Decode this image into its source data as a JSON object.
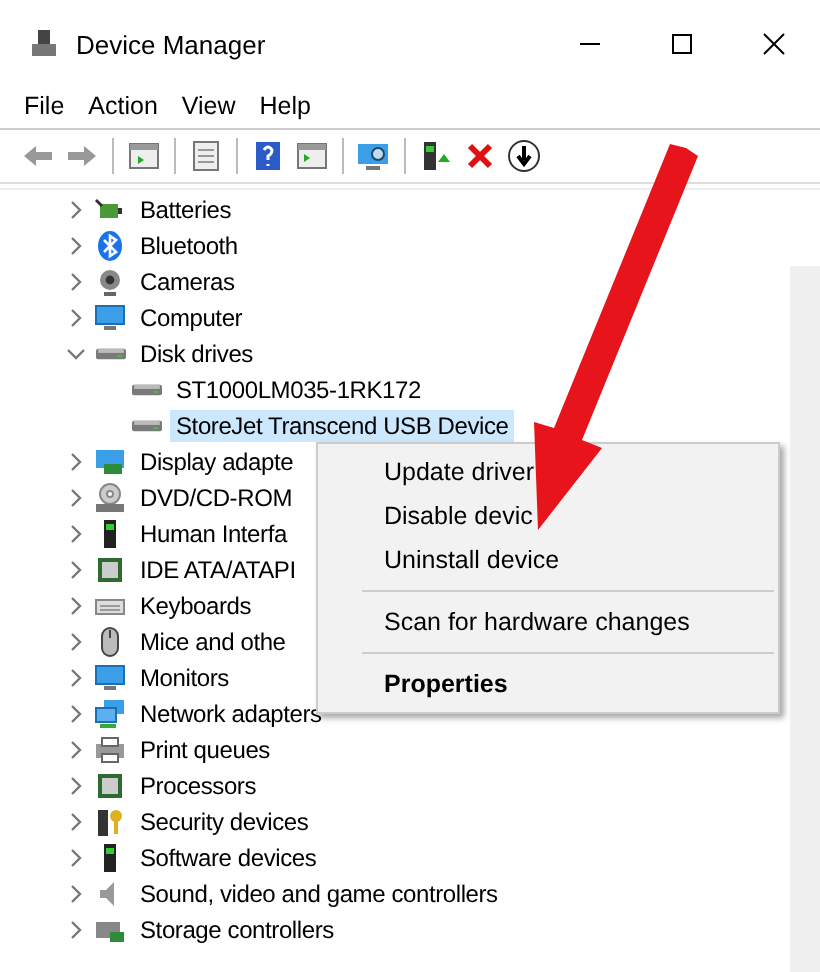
{
  "window": {
    "title": "Device Manager"
  },
  "menu": [
    "File",
    "Action",
    "View",
    "Help"
  ],
  "tree": [
    {
      "label": "Batteries",
      "expanded": false,
      "selected": false
    },
    {
      "label": "Bluetooth",
      "expanded": false,
      "selected": false
    },
    {
      "label": "Cameras",
      "expanded": false,
      "selected": false
    },
    {
      "label": "Computer",
      "expanded": false,
      "selected": false
    },
    {
      "label": "Disk drives",
      "expanded": true,
      "selected": false,
      "children": [
        {
          "label": "ST1000LM035-1RK172",
          "selected": false
        },
        {
          "label": "StoreJet Transcend USB Device",
          "selected": true
        }
      ]
    },
    {
      "label": "Display adapte",
      "expanded": false,
      "selected": false
    },
    {
      "label": "DVD/CD-ROM",
      "expanded": false,
      "selected": false
    },
    {
      "label": "Human Interfa",
      "expanded": false,
      "selected": false
    },
    {
      "label": "IDE ATA/ATAPI",
      "expanded": false,
      "selected": false
    },
    {
      "label": "Keyboards",
      "expanded": false,
      "selected": false
    },
    {
      "label": "Mice and othe",
      "expanded": false,
      "selected": false
    },
    {
      "label": "Monitors",
      "expanded": false,
      "selected": false
    },
    {
      "label": "Network adapters",
      "expanded": false,
      "selected": false
    },
    {
      "label": "Print queues",
      "expanded": false,
      "selected": false
    },
    {
      "label": "Processors",
      "expanded": false,
      "selected": false
    },
    {
      "label": "Security devices",
      "expanded": false,
      "selected": false
    },
    {
      "label": "Software devices",
      "expanded": false,
      "selected": false
    },
    {
      "label": "Sound, video and game controllers",
      "expanded": false,
      "selected": false
    },
    {
      "label": "Storage controllers",
      "expanded": false,
      "selected": false
    }
  ],
  "context_menu": [
    {
      "kind": "item",
      "label": "Update driver",
      "bold": false
    },
    {
      "kind": "item",
      "label": "Disable devic",
      "bold": false
    },
    {
      "kind": "item",
      "label": "Uninstall device",
      "bold": false
    },
    {
      "kind": "separator"
    },
    {
      "kind": "item",
      "label": "Scan for hardware changes",
      "bold": false
    },
    {
      "kind": "separator"
    },
    {
      "kind": "item",
      "label": "Properties",
      "bold": true
    }
  ]
}
